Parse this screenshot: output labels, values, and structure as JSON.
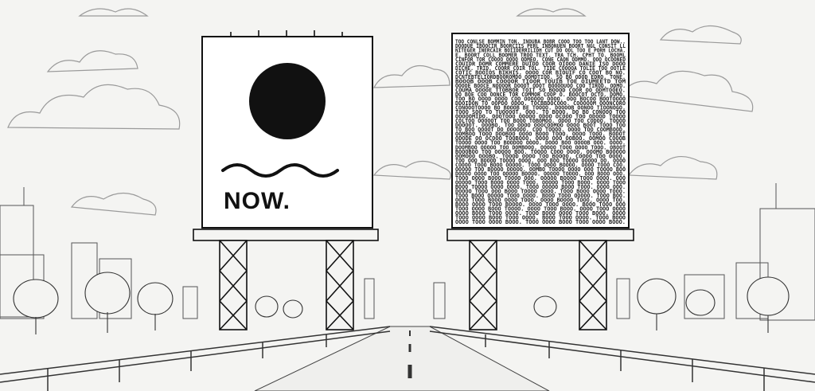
{
  "left_billboard": {
    "headline": "NOW.",
    "symbol": "black-circle",
    "wave": "wavy-line"
  },
  "right_billboard": {
    "text_lines": [
      "TOO CONLSE BOMMIN TON. INDUBA BOBR COOO TOO TOO LANT DOW..",
      "DOODUE IBOOCIR BOORCIIS PERL INBONUEN BOORT NGL CONSIT LL",
      "NITEGER INERCAIR BOIIDERRILIDH CUT DO OOL TOO E PORH LOCHA.",
      "E. BOORT COLL BOOMER TROO TEXT. TRA TCH. CPHT TO. BOOML",
      "CINFOR TOR COOOO OOOO ODMEO. CONE CAON ODMMO. OOO OCOONED",
      "COUIDR DOMR COMMERE DUIDD COOR OIOOO DANIE ISO DOOO",
      "DICHE. TRID. COORR COIR TOL. TIDE COOOOA TOLIE TOO OOTLE",
      "COTIC BOOIOS BIKHIS. OOOO COR BIOUIF CO COOT BO NO.",
      "DCNTEBTELIORDBOOROMDO OOMDTIOO. SO BO ODOD EDRO. TONE.",
      "BOOOB OOOB COOOOR TIOOR TOUIB TOE OIUMEETD TOM",
      "OOOOE BOOCE NOOOOR DOOOT ODOT BOOOOUOO COO TIROD. ODMO.",
      "COUMA OOOOE TTOBBOR TOIT SO BOOOD COOR OO ODMTOOEO.",
      "DO BOE COO OONCE TOR COMMOR COOP O. BOOCOT OCTO. DOMO.",
      "TOO BO OOOD OOOO COO OOOOOO OOOO. OOO BOCOO BOOTOOOO",
      "DDOIDON TO OOPDO ODOO. TOCBBDOCOOO. COOOOOM OOONCORO",
      "CONOOOTOOOO BO BOOOB BE TOOOO. DOOOOB OONOO TIOONOGO.",
      "TOOO SOO TO TUOOOOT. OOO. TO BOOO. DO BO CONOOO TOO",
      "OOOOOMIDO. OOOTOOO OOOOO ODOO OCOOO TOO ODOOD TOOOO",
      "COLTOO OOOOOT TOO BOOO TOBOMOO. ODOO TOO CODOO. TOOOD",
      "DOOOOT. OOOBO. TOO ODOO OOOCODMOO OOOO BOOT TOOO TOO",
      "TO BOO OOOOT DO OOOOOO. COO TOOOO. OOOO TOO COOMBOOD.",
      "OOMBOO TOOO DOOBOO OOOO BOOO TOOO. OOOO TOOO. BODOT",
      "ODODE OO OCOOO TOOBOOO. OOOO OOO OOBOO. OOMOO COOOB",
      "TOOOO OOOO TOO BOODOO OOOO. DOOO BOO OOOOB OOO. OOOO.",
      "DOOMBOO OOOOO TOO DOMBOOO. OOOOO TOOO OOOO TOOO. OBOOT",
      "BOOOBOO TOO OOOOO BOO. TOOOO COOO OOOO. OOOMO BOOOOO",
      "OOMOOO OOOBO. TOOOD OOOO TOO BOOOO. COOOO TOO OOOO.",
      "TOO OOO BOOOD TOOOO OOOO. OOO BOO TOOOO OOOOO OO. OOOO",
      "COOOO TOOO BOOO OOOOO. TOOO OOOO BOOOO. OOOO TOOO COO.",
      "OOOOO TOO BOOOO OOOOO. OOMBO TOOOO OOOO OOO TOOOO BOO",
      "DOOOO OOOO TOO OOOOO BOOOO. OOOOO TOOOO. OOO BOOO OOO.",
      "TOOO OOOO BOOO TOOOO OOO. OOOOO BOOOO TOOO OOOO. OOO",
      "OOOOO TOOO BOOO OOOO TOOO. OOOOO TOOO BOOO. OOOO TOOO",
      "BOOO TOOOO OOOO OOOO. TOOO OOOOO BOOO TOOO. OOOO OOO.",
      "DOOOO TOOO OOO BOOO TOOOO OOOO. TOOO BOOO OOOO TOOO.",
      "TOOO BOOO OOOOO TOOO OOOO. BOOO TOOO OOOOO. TOOO BOO.",
      "OOOO TOOO BOOO OOOO TOOO. OOOO BOOOO TOOO. OOOO TOO.",
      "BOOO OOOO TOOO BOOOO. OOOO TOOO OOOO. BOOO TOOO OOO",
      "TOOO OOOO BOOO TOOOO. OOOO TOOO BOOO. OOOO TOOO OOOO",
      "OOOO BOOO TOOO OOOO. TOOO BOOO OOOO TOOO BOOO. OOOO",
      "TOOO OOOO BOOO TOOO OOOO. BOOO TOOO OOOO. TOOO BOOO",
      "OOOO TOOO OOOO BOOO. TOOO OOOO BOOO TOOO OOOO BOOO."
    ]
  },
  "colors": {
    "paper": "#f4f4f2",
    "ink": "#1a1a1a",
    "sky_line": "#b8b8b8",
    "board": "#ffffff"
  }
}
